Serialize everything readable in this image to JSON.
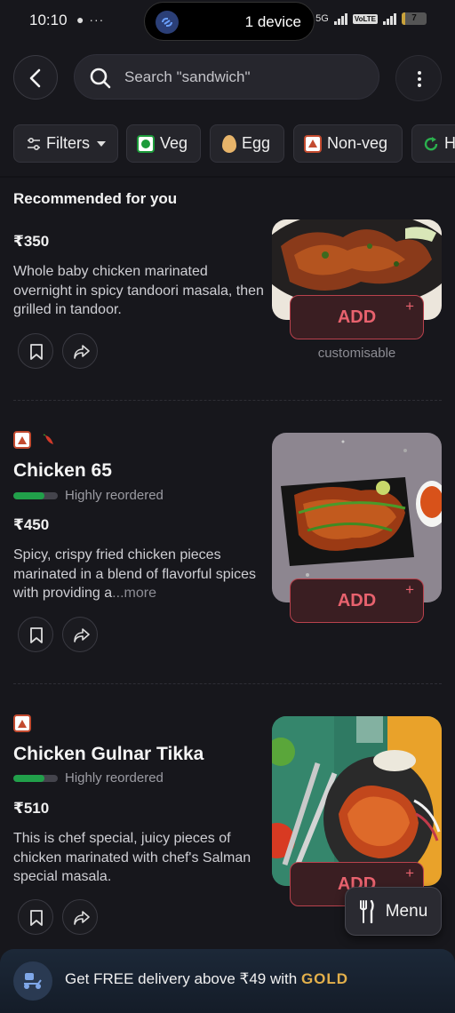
{
  "status_bar": {
    "time": "10:10",
    "left_icons": "● ···",
    "island_text": "1 device",
    "network": "5G",
    "battery": "7",
    "battery_level": 0.07
  },
  "header": {
    "search_placeholder": "Search \"sandwich\""
  },
  "filters": [
    {
      "label": "Filters",
      "icon": "sliders-icon"
    },
    {
      "label": "Veg",
      "icon": "veg-icon"
    },
    {
      "label": "Egg",
      "icon": "egg-icon"
    },
    {
      "label": "Non-veg",
      "icon": "non-veg-icon"
    },
    {
      "label": "H",
      "icon": "refresh-icon"
    }
  ],
  "section_title": "Recommended for you",
  "dishes": [
    {
      "price": "₹350",
      "description": "Whole baby chicken marinated overnight in spicy tandoori masala, then grilled in tandoor.",
      "add_label": "ADD",
      "plus": "+",
      "note": "customisable"
    },
    {
      "name": "Chicken 65",
      "badge": "Highly reordered",
      "price": "₹450",
      "description": "Spicy, crispy fried chicken pieces marinated in a blend of flavorful spices with providing a",
      "more": "...more",
      "add_label": "ADD",
      "plus": "+"
    },
    {
      "name": "Chicken Gulnar Tikka",
      "badge": "Highly reordered",
      "price": "₹510",
      "description": "This is chef special, juicy pieces of chicken marinated with chef's Salman special masala.",
      "add_label": "ADD",
      "plus": "+"
    }
  ],
  "menu_button": "Menu",
  "gold_banner": {
    "text": "Get FREE delivery above ₹49 with ",
    "gold": "GOLD"
  },
  "colors": {
    "background": "#17171c",
    "add_accent": "#e8626e",
    "veg": "#1c9a3a",
    "non_veg": "#c34b30",
    "gold": "#e3b04b"
  }
}
